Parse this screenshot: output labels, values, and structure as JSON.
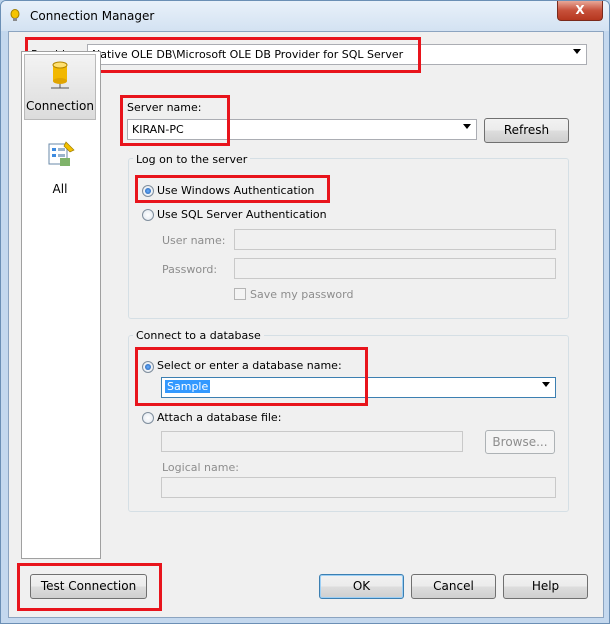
{
  "window": {
    "title": "Connection Manager",
    "close_glyph": "X"
  },
  "provider": {
    "label": "Provider:",
    "value": "Native OLE DB\\Microsoft OLE DB Provider for SQL Server"
  },
  "sidebar": {
    "items": [
      {
        "label": "Connection",
        "icon": "database-cylinder-icon",
        "selected": true
      },
      {
        "label": "All",
        "icon": "properties-list-icon",
        "selected": false
      }
    ]
  },
  "server": {
    "label": "Server name:",
    "value": "KIRAN-PC",
    "refresh_label": "Refresh"
  },
  "logon": {
    "group_title": "Log on to the server",
    "windows_auth_label": "Use Windows Authentication",
    "sql_auth_label": "Use SQL Server Authentication",
    "selected": "windows",
    "username_label": "User name:",
    "username_value": "",
    "password_label": "Password:",
    "password_value": "",
    "save_password_label": "Save my password",
    "save_password_checked": false
  },
  "database": {
    "group_title": "Connect to a database",
    "select_db_label": "Select or enter a database name:",
    "db_name_value": "Sample",
    "attach_label": "Attach a database file:",
    "attach_file_value": "",
    "browse_label": "Browse...",
    "logical_name_label": "Logical name:",
    "logical_name_value": "",
    "selected": "select"
  },
  "footer": {
    "test_connection_label": "Test Connection",
    "ok_label": "OK",
    "cancel_label": "Cancel",
    "help_label": "Help"
  },
  "colors": {
    "highlight_box": "#e8141c",
    "selection": "#3399ff"
  }
}
